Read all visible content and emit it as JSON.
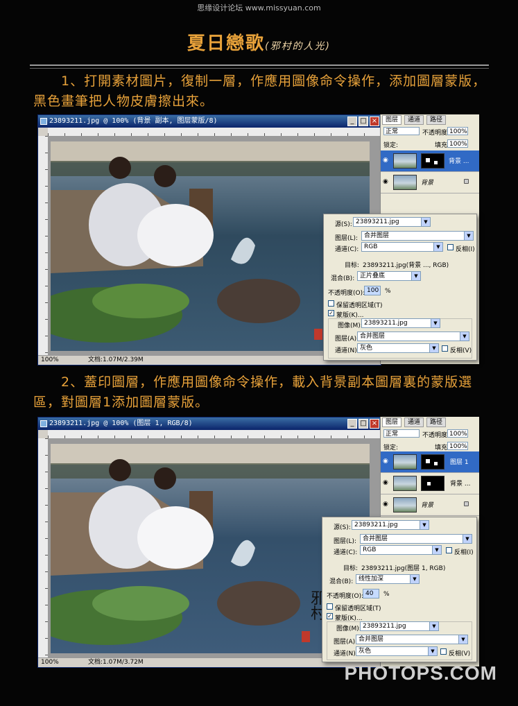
{
  "watermark": "思缘设计论坛 www.missyuan.com",
  "title": "夏日戀歌",
  "title_signature": "(邪村的人光)",
  "step1_text": "1、打開素材圖片，復制一層，作應用圖像命令操作，添加圖層蒙版，黑色畫筆把人物皮膚擦出來。",
  "step2_text": "2、蓋印圖層，作應用圖像命令操作，載入背景副本圖層裏的蒙版選區，對圖層1添加圖層蒙版。",
  "footer_mark": "PHOTOPS.COM",
  "colors": {
    "accent": "#e8a23a",
    "titlebar": "#0a246a",
    "selected_layer": "#316ac5"
  },
  "window1": {
    "title": "23893211.jpg @ 100% (背景 副本, 图层蒙版/8)",
    "zoom": "100%",
    "doc": "文档:1.07M/2.39M",
    "panel": {
      "tabs": [
        "图层",
        "通道",
        "路径"
      ],
      "blend_mode": "正常",
      "opacity_label": "不透明度:",
      "opacity": "100%",
      "lock_label": "锁定:",
      "fill_label": "填充:",
      "fill": "100%",
      "layers": [
        {
          "name": "背景 ...",
          "selected": true
        },
        {
          "name": "背景",
          "selected": false
        }
      ]
    },
    "dialog": {
      "source_label": "源(S):",
      "source": "23893211.jpg",
      "layer_label": "图层(L):",
      "layer": "合并图层",
      "channel_label": "通道(C):",
      "channel": "RGB",
      "invert_label": "反相(I)",
      "target_label": "目标:",
      "target": "23893211.jpg(背景 ..., RGB)",
      "blend_label": "混合(B):",
      "blend": "正片叠底",
      "opacity_label": "不透明度(O):",
      "opacity": "100",
      "percent": "%",
      "preserve_label": "保留透明区域(T)",
      "mask_label": "蒙版(K)...",
      "image_label": "图像(M):",
      "image": "23893211.jpg",
      "mask_layer_label": "图层(A):",
      "mask_layer": "合并图层",
      "mask_channel_label": "通道(N):",
      "mask_channel": "灰色",
      "mask_invert_label": "反相(V)"
    }
  },
  "window2": {
    "title": "23893211.jpg @ 100% (图层 1, RGB/8)",
    "zoom": "100%",
    "doc": "文档:1.07M/3.72M",
    "panel": {
      "tabs": [
        "图层",
        "通道",
        "路径"
      ],
      "blend_mode": "正常",
      "opacity_label": "不透明度:",
      "opacity": "100%",
      "lock_label": "锁定:",
      "fill_label": "填充:",
      "fill": "100%",
      "layers": [
        {
          "name": "图层 1",
          "selected": true
        },
        {
          "name": "背景 ...",
          "selected": false
        },
        {
          "name": "背景",
          "selected": false
        }
      ]
    },
    "dialog": {
      "source_label": "源(S):",
      "source": "23893211.jpg",
      "layer_label": "图层(L):",
      "layer": "合并图层",
      "channel_label": "通道(C):",
      "channel": "RGB",
      "invert_label": "反相(I)",
      "target_label": "目标:",
      "target": "23893211.jpg(图层 1, RGB)",
      "blend_label": "混合(B):",
      "blend": "线性加深",
      "opacity_label": "不透明度(O):",
      "opacity": "40",
      "percent": "%",
      "preserve_label": "保留透明区域(T)",
      "mask_label": "蒙版(K)...",
      "image_label": "图像(M):",
      "image": "23893211.jpg",
      "mask_layer_label": "图层(A):",
      "mask_layer": "合并图层",
      "mask_channel_label": "通道(N):",
      "mask_channel": "灰色",
      "mask_invert_label": "反相(V)"
    }
  }
}
